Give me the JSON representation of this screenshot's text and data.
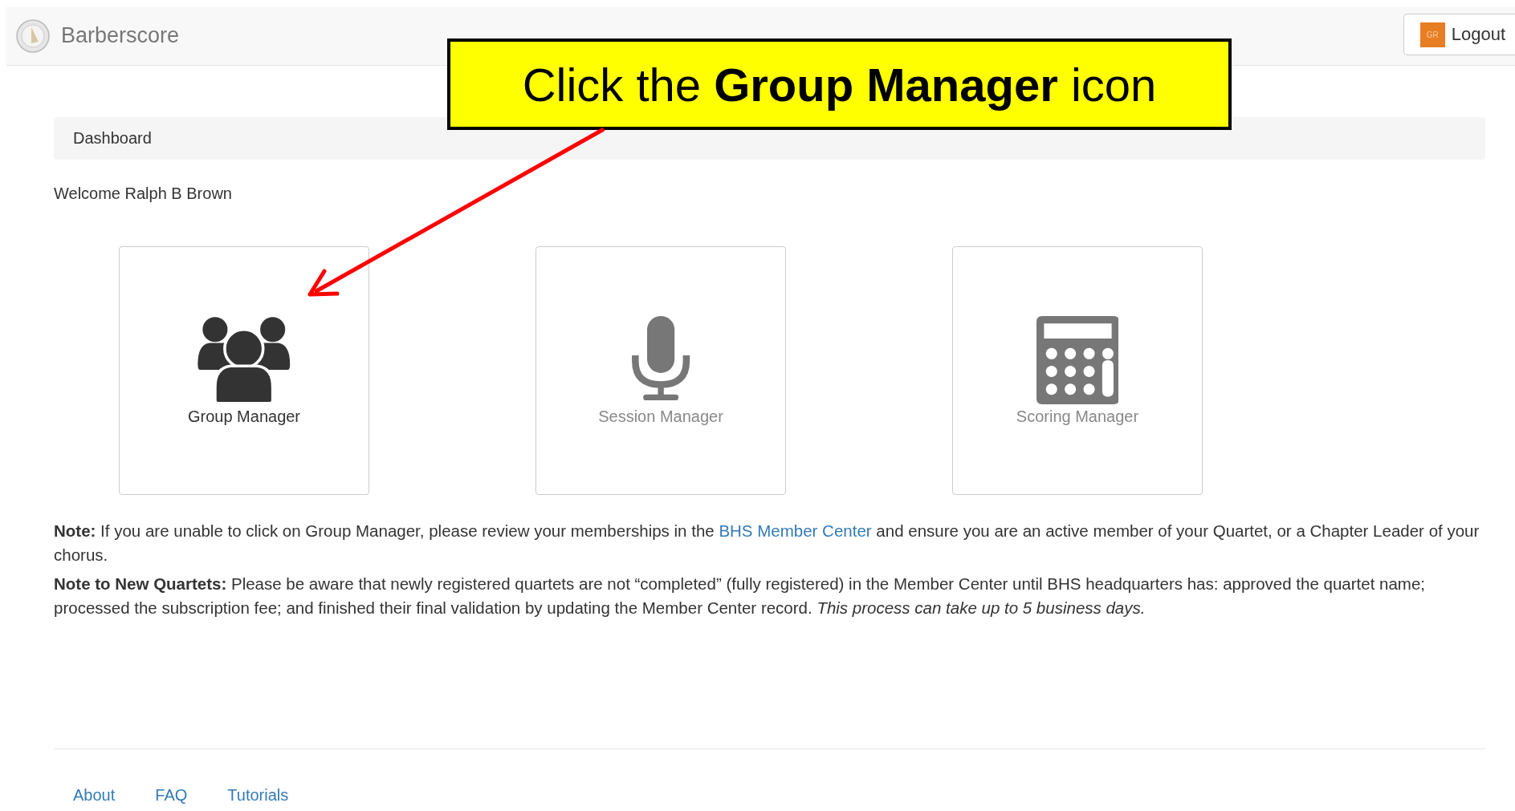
{
  "header": {
    "brand": "Barberscore",
    "logout": {
      "badge": "GR",
      "label": "Logout"
    }
  },
  "callout": {
    "text": "Click the **Group Manager** icon"
  },
  "breadcrumb": "Dashboard",
  "welcome": "Welcome Ralph B Brown",
  "tiles": [
    {
      "kind": "group",
      "label": "Group Manager",
      "disabled": false
    },
    {
      "kind": "mic",
      "label": "Session Manager",
      "disabled": true
    },
    {
      "kind": "calculator",
      "label": "Scoring Manager",
      "disabled": true
    }
  ],
  "notes": [
    {
      "parts": [
        {
          "kind": "text",
          "text": "**Note:** If you are unable to click on Group Manager, please review your memberships in the"
        },
        {
          "kind": "link",
          "text": "BHS Member Center"
        },
        {
          "kind": "text",
          "text": "and ensure you are an active member of your Quartet, or a Chapter Leader of your chorus."
        }
      ]
    },
    {
      "parts": [
        {
          "kind": "text",
          "text": "**Note to New Quartets:** Please be aware that newly registered quartets are not “completed” (fully registered) in the Member Center until BHS headquarters has: approved the quartet name; processed the subscription fee; and finished their final validation by updating the Member Center record. *This process can take up to 5 business days.*"
        }
      ]
    }
  ],
  "footer": [
    "About",
    "FAQ",
    "Tutorials"
  ]
}
